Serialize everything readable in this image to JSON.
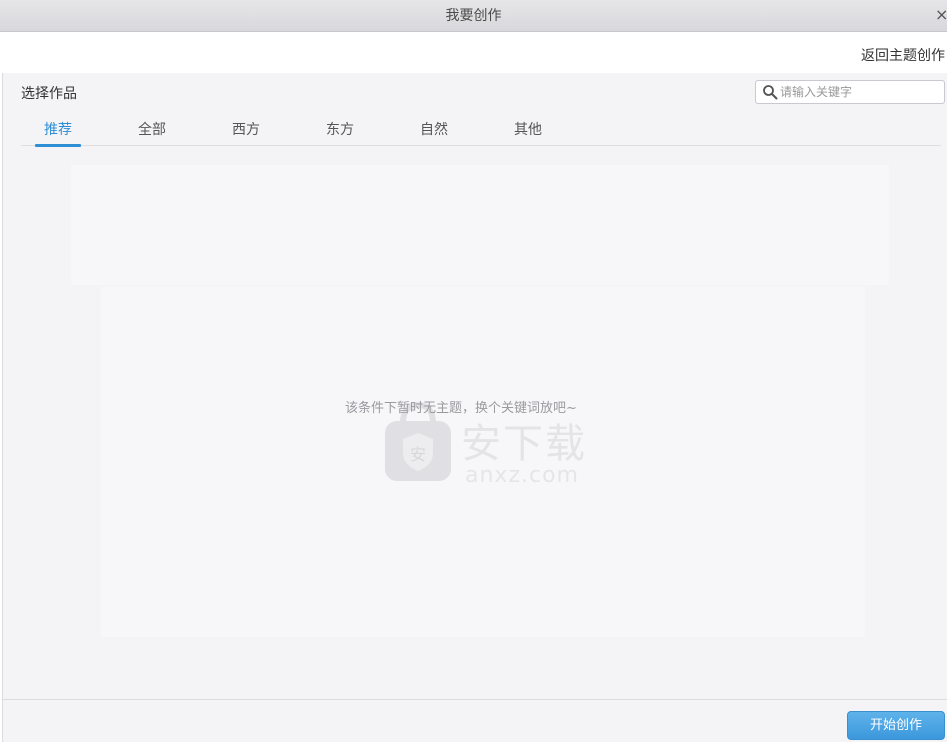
{
  "window": {
    "title": "我要创作",
    "close_glyph": "×"
  },
  "header": {
    "back_link": "返回主题创作"
  },
  "main": {
    "section_title": "选择作品",
    "search": {
      "placeholder": "请输入关键字",
      "value": ""
    },
    "tabs": [
      {
        "label": "推荐",
        "active": true
      },
      {
        "label": "全部",
        "active": false
      },
      {
        "label": "西方",
        "active": false
      },
      {
        "label": "东方",
        "active": false
      },
      {
        "label": "自然",
        "active": false
      },
      {
        "label": "其他",
        "active": false
      }
    ],
    "empty_message": "该条件下暂时无主题，换个关键词放吧~"
  },
  "watermark": {
    "name": "安下载",
    "url": "anxz.com",
    "shield_glyph": "安"
  },
  "footer": {
    "start_button": "开始创作"
  },
  "colors": {
    "accent": "#2f8fd6",
    "button": "#3b98dc",
    "background": "#f4f3f6"
  }
}
